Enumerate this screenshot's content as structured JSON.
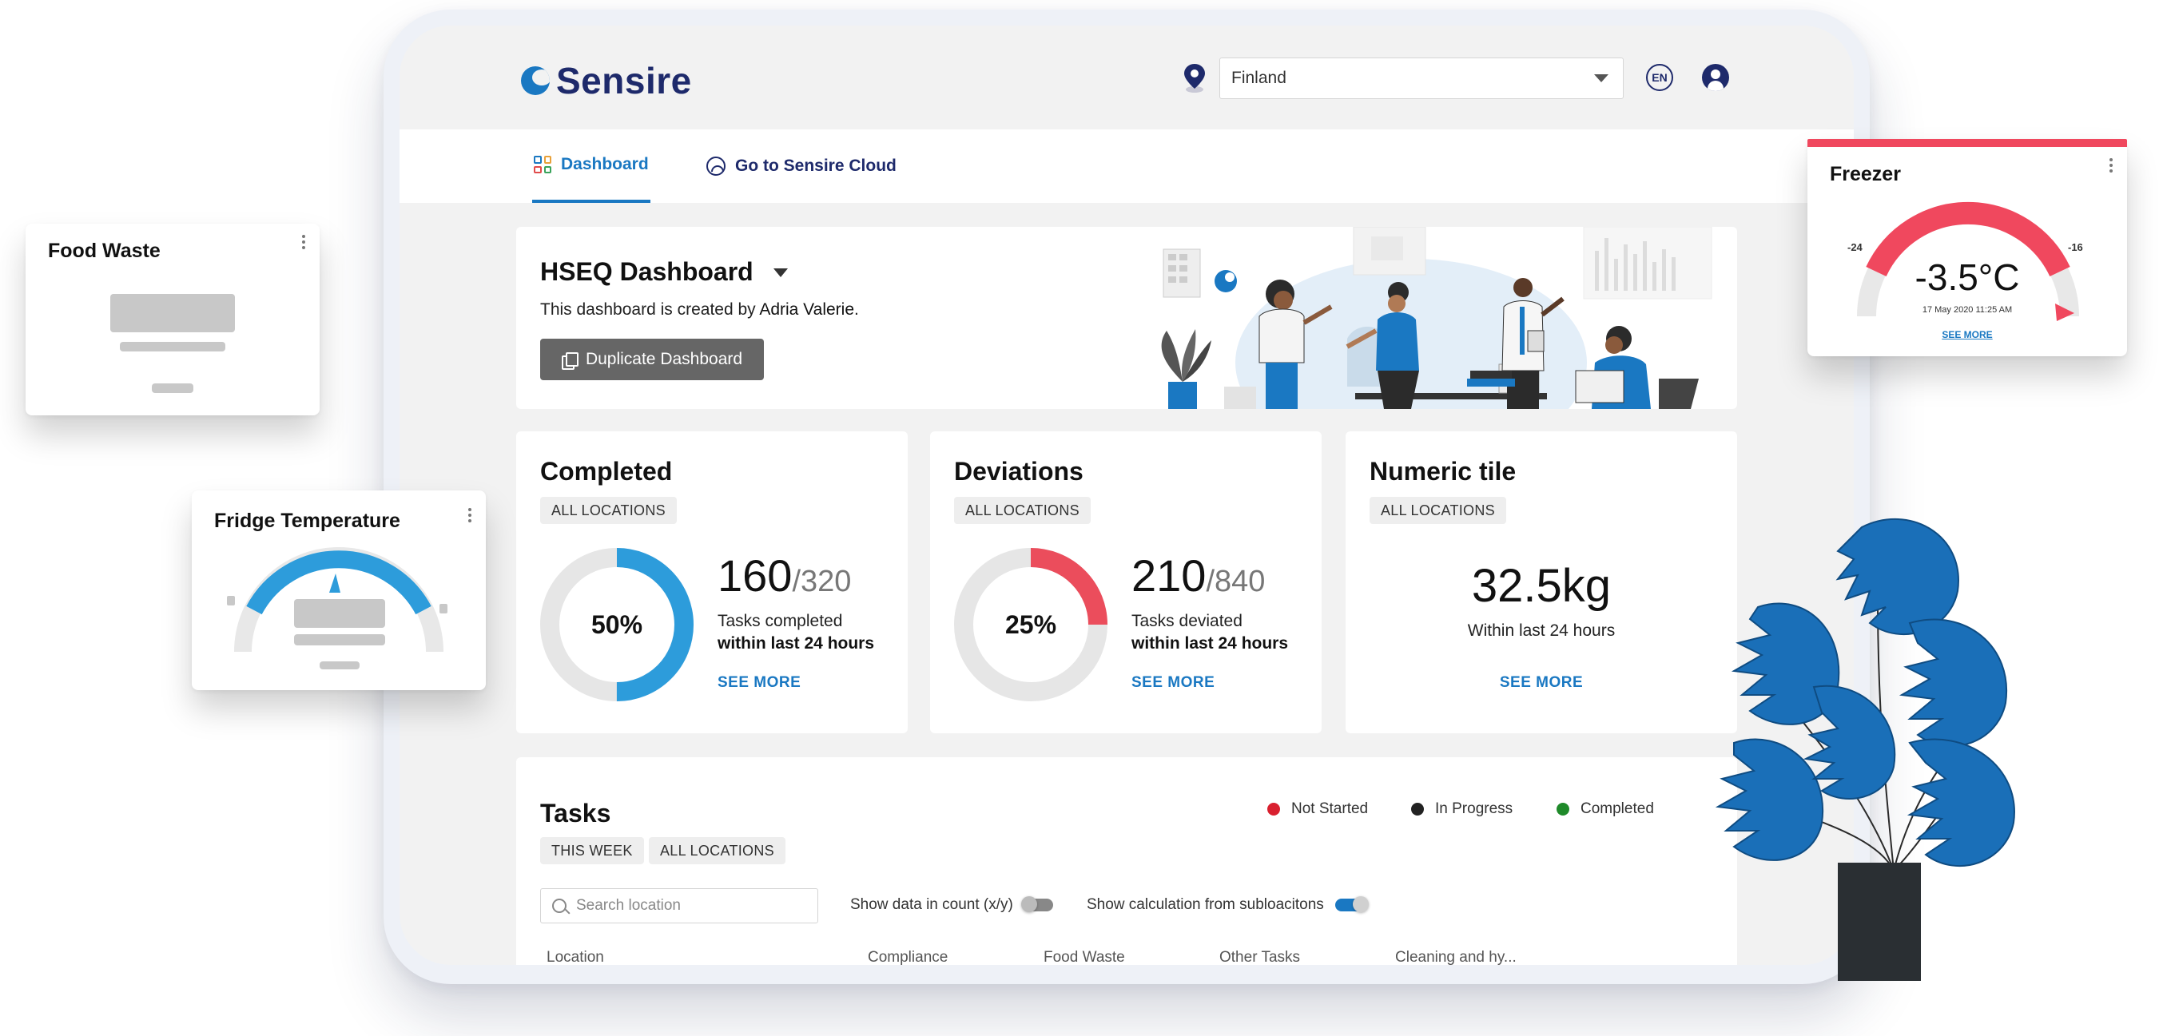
{
  "header": {
    "brand": "Sensire",
    "country": "Finland",
    "language": "EN"
  },
  "nav": {
    "dashboard": "Dashboard",
    "cloud": "Go to Sensire Cloud"
  },
  "hseq": {
    "title": "HSEQ Dashboard",
    "created_prefix": "This dashboard is created by ",
    "author": "Adria Valerie",
    "created_suffix": ".",
    "duplicate_label": "Duplicate Dashboard"
  },
  "completed": {
    "title": "Completed",
    "chip": "ALL LOCATIONS",
    "percent": "50%",
    "fraction": 0.5,
    "value": "160",
    "total": "/320",
    "line1": "Tasks completed",
    "line2": "within last 24 hours",
    "see_more": "SEE MORE",
    "color": "#2d9cdb"
  },
  "deviations": {
    "title": "Deviations",
    "chip": "ALL LOCATIONS",
    "percent": "25%",
    "fraction": 0.25,
    "value": "210",
    "total": "/840",
    "line1": "Tasks deviated",
    "line2": "within last 24 hours",
    "see_more": "SEE MORE",
    "color": "#eb4d5c"
  },
  "numeric": {
    "title": "Numeric tile",
    "chip": "ALL LOCATIONS",
    "value": "32.5kg",
    "sub": "Within last 24 hours",
    "see_more": "SEE MORE"
  },
  "tasks": {
    "title": "Tasks",
    "chip_week": "THIS WEEK",
    "chip_locations": "ALL LOCATIONS",
    "legend": [
      {
        "label": "Not Started",
        "color": "#d9202f"
      },
      {
        "label": "In Progress",
        "color": "#222222"
      },
      {
        "label": "Completed",
        "color": "#1f8a2a"
      }
    ],
    "search_placeholder": "Search location",
    "toggle1": "Show data in count (x/y)",
    "toggle1_on": false,
    "toggle2": "Show calculation from subloacitons",
    "toggle2_on": true,
    "columns": [
      "Location",
      "Compliance",
      "Food Waste",
      "Other Tasks",
      "Cleaning and hy..."
    ]
  },
  "widgets": {
    "food_waste": {
      "title": "Food Waste"
    },
    "fridge": {
      "title": "Fridge Temperature",
      "color": "#2d9cdb"
    },
    "freezer": {
      "title": "Freezer",
      "min": "-24",
      "max": "-16",
      "value": "-3.5°C",
      "timestamp": "17 May 2020  11:25 AM",
      "see_more": "SEE MORE",
      "color": "#f0485e"
    }
  }
}
